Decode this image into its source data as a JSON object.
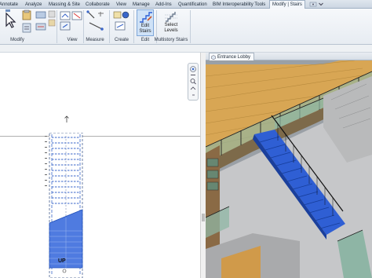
{
  "ribbon_tabs": [
    {
      "label": "Annotate"
    },
    {
      "label": "Analyze"
    },
    {
      "label": "Massing & Site"
    },
    {
      "label": "Collaborate"
    },
    {
      "label": "View"
    },
    {
      "label": "Manage"
    },
    {
      "label": "Add-Ins"
    },
    {
      "label": "Quantification"
    },
    {
      "label": "BIM Interoperability Tools"
    },
    {
      "label": "Modify | Stairs"
    }
  ],
  "ribbon_groups": {
    "modify": "Modify",
    "view": "View",
    "measure": "Measure",
    "create": "Create",
    "edit": "Edit",
    "multistory": "Multistory Stairs"
  },
  "buttons": {
    "edit_stairs_line1": "Edit",
    "edit_stairs_line2": "Stairs",
    "select_levels_line1": "Select",
    "select_levels_line2": "Levels"
  },
  "view_tab": {
    "label": "Entrance Lobby"
  },
  "plan": {
    "up_label": "UP"
  },
  "colors": {
    "accent": "#3a66c9",
    "stair_selected": "#2d5fd6",
    "wood": "#d9a653",
    "floor": "#c4c4c4",
    "ribbon_bg": "#eef2f7"
  },
  "icons": [
    "modify-arrow-icon",
    "paste-icon",
    "cut-icon",
    "join-icon",
    "view-icon",
    "measure-icon",
    "create-icon",
    "edit-stairs-icon",
    "select-levels-icon",
    "close-icon",
    "options-icon",
    "zoom-icon"
  ]
}
